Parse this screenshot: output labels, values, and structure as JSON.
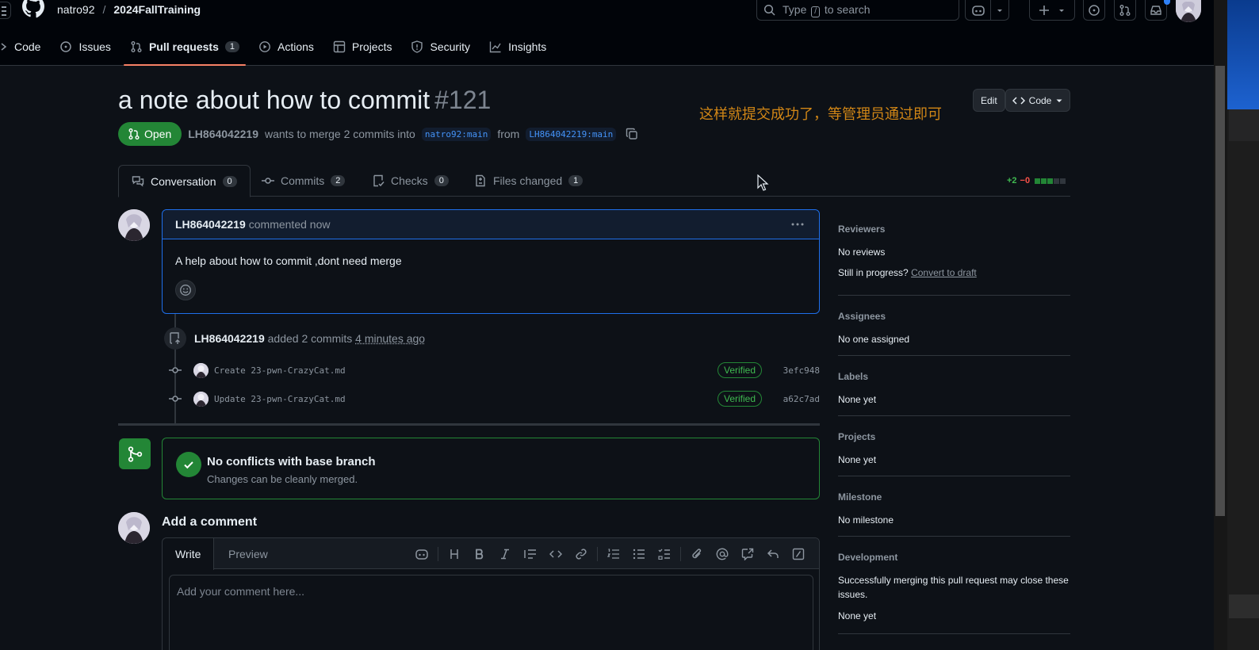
{
  "header": {
    "owner": "natro92",
    "separator": "/",
    "repo": "2024FallTraining",
    "search_prefix": "Type",
    "search_key": "/",
    "search_suffix": "to search"
  },
  "repo_nav": [
    {
      "label": "Code",
      "icon": "code-icon"
    },
    {
      "label": "Issues",
      "icon": "issue-icon"
    },
    {
      "label": "Pull requests",
      "icon": "pull-request-icon",
      "count": "1",
      "active": true
    },
    {
      "label": "Actions",
      "icon": "play-icon"
    },
    {
      "label": "Projects",
      "icon": "table-icon"
    },
    {
      "label": "Security",
      "icon": "shield-icon"
    },
    {
      "label": "Insights",
      "icon": "graph-icon"
    }
  ],
  "pr": {
    "title": "a note about how to commit",
    "number": "#121",
    "state": "Open",
    "author": "LH864042219",
    "merge_text": "wants to merge 2 commits into",
    "base_branch": "natro92:main",
    "from_text": "from",
    "head_branch": "LH864042219:main",
    "edit_label": "Edit",
    "code_label": "Code"
  },
  "annotation": "这样就提交成功了，等管理员通过即可",
  "tabs": [
    {
      "label": "Conversation",
      "count": "0",
      "icon": "comment-discussion-icon"
    },
    {
      "label": "Commits",
      "count": "2",
      "icon": "commit-icon"
    },
    {
      "label": "Checks",
      "count": "0",
      "icon": "checklist-icon"
    },
    {
      "label": "Files changed",
      "count": "1",
      "icon": "file-diff-icon"
    }
  ],
  "diffstat": {
    "additions": "+2",
    "deletions": "−0",
    "boxes": [
      "green",
      "green",
      "green",
      "gray",
      "gray"
    ]
  },
  "comment": {
    "author": "LH864042219",
    "meta": "commented now",
    "body": "A help about how to commit ,dont need merge"
  },
  "timeline": {
    "author": "LH864042219",
    "action": "added 2 commits",
    "time": "4 minutes ago",
    "commits": [
      {
        "message": "Create 23-pwn-CrazyCat.md",
        "badge": "Verified",
        "sha": "3efc948"
      },
      {
        "message": "Update 23-pwn-CrazyCat.md",
        "badge": "Verified",
        "sha": "a62c7ad"
      }
    ]
  },
  "merge": {
    "title": "No conflicts with base branch",
    "subtitle": "Changes can be cleanly merged."
  },
  "add_comment": {
    "title": "Add a comment",
    "write_tab": "Write",
    "preview_tab": "Preview",
    "placeholder": "Add your comment here..."
  },
  "sidebar": {
    "reviewers": {
      "heading": "Reviewers",
      "value": "No reviews",
      "progress_text": "Still in progress?",
      "draft_link": "Convert to draft"
    },
    "assignees": {
      "heading": "Assignees",
      "value": "No one assigned"
    },
    "labels": {
      "heading": "Labels",
      "value": "None yet"
    },
    "projects": {
      "heading": "Projects",
      "value": "None yet"
    },
    "milestone": {
      "heading": "Milestone",
      "value": "No milestone"
    },
    "development": {
      "heading": "Development",
      "description": "Successfully merging this pull request may close these issues.",
      "value": "None yet"
    }
  },
  "colors": {
    "accent": "#238636",
    "link": "#4493f8",
    "tab_underline": "#f78166",
    "annotation": "#d18616"
  }
}
